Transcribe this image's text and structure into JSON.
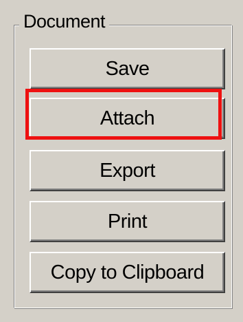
{
  "group": {
    "title": "Document"
  },
  "buttons": {
    "save": "Save",
    "attach": "Attach",
    "export": "Export",
    "print": "Print",
    "copy_to_clipboard": "Copy to Clipboard"
  },
  "colors": {
    "face": "#d4d0c8",
    "highlight": "#ee1111"
  }
}
